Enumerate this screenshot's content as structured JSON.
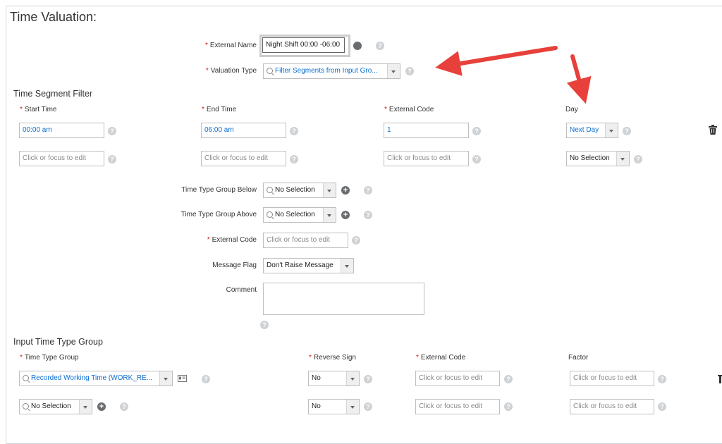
{
  "page": {
    "title": "Time Valuation:",
    "external_name": {
      "label": "External Name",
      "value": "Night Shift 00:00 -06:00"
    },
    "valuation_type": {
      "label": "Valuation Type",
      "value": "Filter Segments from Input Gro..."
    }
  },
  "segment_filter": {
    "title": "Time Segment Filter",
    "headers": {
      "start": "Start Time",
      "end": "End Time",
      "code": "External Code",
      "day": "Day"
    },
    "rows": [
      {
        "start": "00:00 am",
        "end": "06:00 am",
        "code": "1",
        "day": "Next Day"
      },
      {
        "start": "Click or focus to edit",
        "end": "Click or focus to edit",
        "code": "Click or focus to edit",
        "day": "No Selection"
      }
    ]
  },
  "details": {
    "ttg_below": {
      "label": "Time Type Group Below",
      "value": "No Selection"
    },
    "ttg_above": {
      "label": "Time Type Group Above",
      "value": "No Selection"
    },
    "external_code": {
      "label": "External Code",
      "placeholder": "Click or focus to edit"
    },
    "message_flag": {
      "label": "Message Flag",
      "value": "Don't Raise Message"
    },
    "comment": {
      "label": "Comment"
    }
  },
  "input_group": {
    "title": "Input Time Type Group",
    "headers": {
      "ttg": "Time Type Group",
      "reverse": "Reverse Sign",
      "code": "External Code",
      "factor": "Factor"
    },
    "rows": [
      {
        "ttg": "Recorded Working Time (WORK_RE...",
        "reverse": "No",
        "code": "Click or focus to edit",
        "factor": "Click or focus to edit"
      },
      {
        "ttg": "No Selection",
        "reverse": "No",
        "code": "Click or focus to edit",
        "factor": "Click or focus to edit"
      }
    ]
  },
  "colors": {
    "accent": "#0a6ed1",
    "required": "#cc1919",
    "arrow": "#e8403a"
  }
}
